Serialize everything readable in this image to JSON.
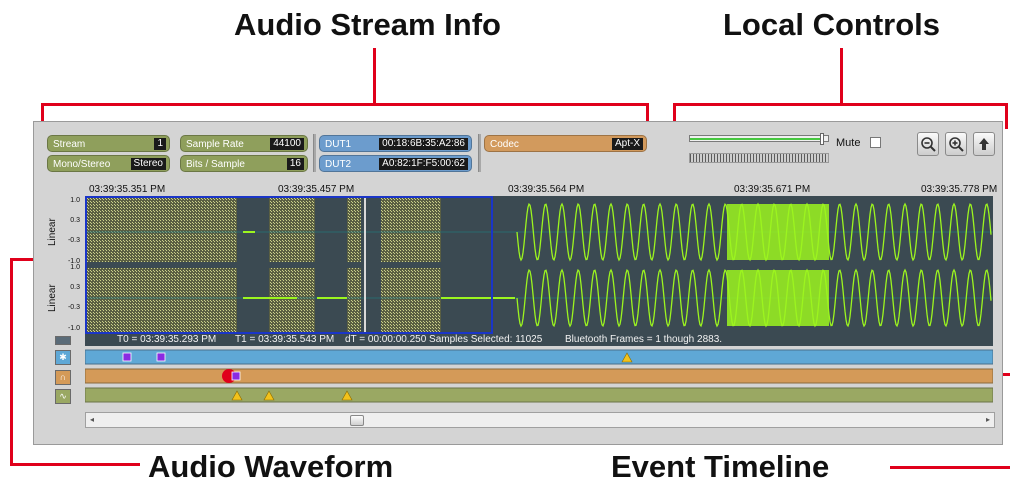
{
  "callouts": {
    "audio_stream_info": "Audio Stream Info",
    "local_controls": "Local Controls",
    "audio_waveform": "Audio Waveform",
    "event_timeline": "Event Timeline"
  },
  "stream_info": {
    "stream_label": "Stream",
    "stream_value": "1",
    "mono_stereo_label": "Mono/Stereo",
    "mono_stereo_value": "Stereo",
    "sample_rate_label": "Sample Rate",
    "sample_rate_value": "44100",
    "bits_label": "Bits / Sample",
    "bits_value": "16",
    "dut1_label": "DUT1",
    "dut1_value": "00:18:6B:35:A2:86",
    "dut2_label": "DUT2",
    "dut2_value": "A0:82:1F:F5:00:62",
    "codec_label": "Codec",
    "codec_value": "Apt-X"
  },
  "controls": {
    "mute_label": "Mute",
    "volume_level": 0.97,
    "zoom_out_icon": "zoom-out-icon",
    "zoom_in_icon": "zoom-in-icon",
    "up_icon": "arrow-up-icon"
  },
  "waveform": {
    "timestamps": [
      "03:39:35.351 PM",
      "03:39:35.457 PM",
      "03:39:35.564 PM",
      "03:39:35.671 PM",
      "03:39:35.778 PM"
    ],
    "y_title": "Linear",
    "y_ticks_top": [
      "1.0",
      "0.3",
      "-0.3",
      "-1.0"
    ],
    "y_ticks_bottom": [
      "1.0",
      "0.3",
      "-0.3",
      "-1.0"
    ],
    "status": {
      "t0": "T0 = 03:39:35.293 PM",
      "t1": "T1 = 03:39:35.543 PM",
      "dt": "dT = 00:00:00.250 Samples Selected: 11025",
      "frames": "Bluetooth Frames = 1 though 2883."
    },
    "colors": {
      "background": "#3b4a52",
      "signal": "#9cf51f",
      "selection": "#1a35c8"
    }
  },
  "timeline": {
    "lane_colors": [
      "#5fa8d6",
      "#d49a58",
      "#9aa863"
    ],
    "lane_icons": [
      "bluetooth-icon",
      "headset-icon",
      "waveform-icon"
    ]
  }
}
